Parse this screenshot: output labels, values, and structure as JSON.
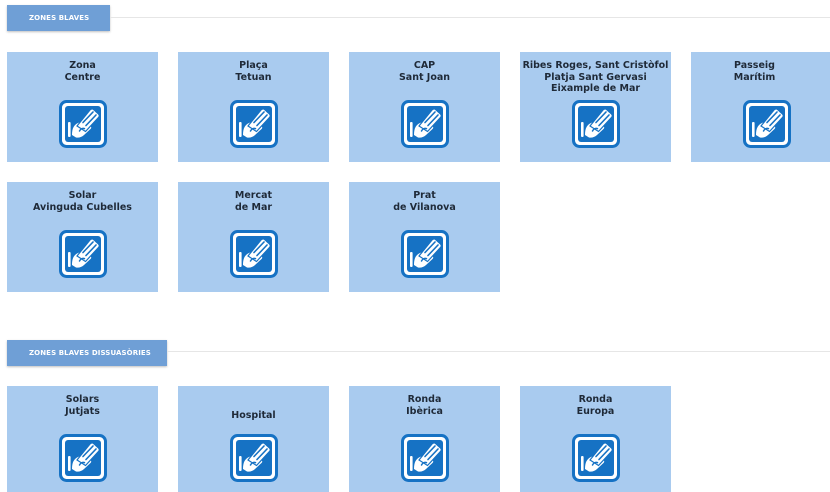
{
  "sections": [
    {
      "title": "ZONES BLAVES",
      "tiles": [
        {
          "label": "Zona\nCentre"
        },
        {
          "label": "Plaça\nTetuan"
        },
        {
          "label": "CAP\nSant Joan"
        },
        {
          "label": "Ribes Roges, Sant Cristòfol\nPlatja Sant Gervasi\nEixample de Mar"
        },
        {
          "label": "Passeig\nMarítim"
        },
        {
          "label": "Solar\nAvinguda Cubelles"
        },
        {
          "label": "Mercat\nde Mar"
        },
        {
          "label": "Prat\nde Vilanova"
        }
      ]
    },
    {
      "title": "ZONES BLAVES DISSUASÒRIES",
      "tiles": [
        {
          "label": "Solars\nJutjats"
        },
        {
          "label": "Hospital"
        },
        {
          "label": "Ronda\nIbèrica"
        },
        {
          "label": "Ronda\nEuropa"
        }
      ]
    }
  ],
  "icon": "hand-card-payment-icon",
  "colors": {
    "tile_background": "#a9cbef",
    "header_background": "#6f9fd6",
    "icon_blue": "#1672c4"
  }
}
